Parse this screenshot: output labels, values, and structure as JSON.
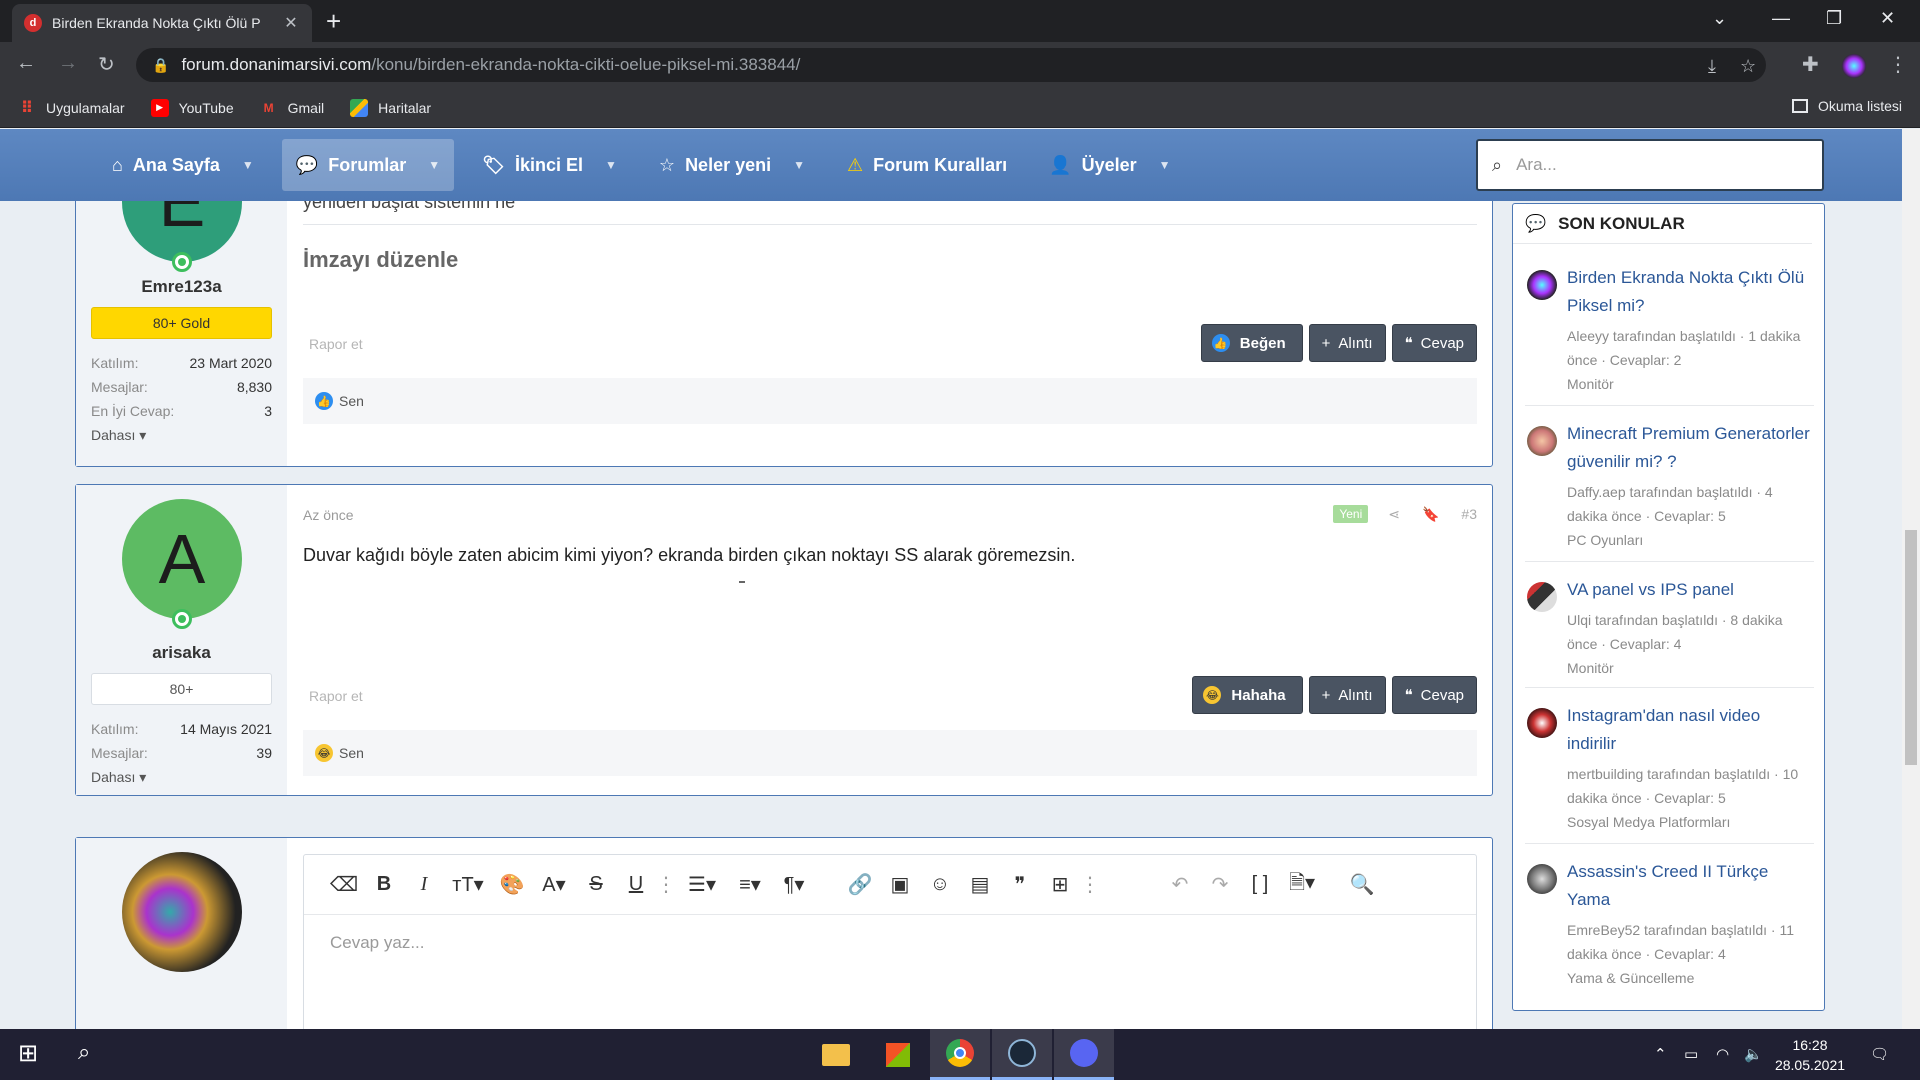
{
  "browser": {
    "tab_title": "Birden Ekranda Nokta Çıktı Ölü P",
    "url_host": "forum.donanimarsivi.com",
    "url_path": "/konu/birden-ekranda-nokta-cikti-oelue-piksel-mi.383844/",
    "bookmarks": [
      "Uygulamalar",
      "YouTube",
      "Gmail",
      "Haritalar"
    ],
    "reading_list": "Okuma listesi"
  },
  "nav": {
    "items": [
      "Ana Sayfa",
      "Forumlar",
      "İkinci El",
      "Neler yeni",
      "Forum Kuralları",
      "Üyeler"
    ],
    "search_placeholder": "Ara..."
  },
  "post1": {
    "avatar_letter": "E",
    "username": "Emre123a",
    "badge": "80+ Gold",
    "stats": [
      {
        "label": "Katılım:",
        "value": "23 Mart 2020"
      },
      {
        "label": "Mesajlar:",
        "value": "8,830"
      },
      {
        "label": "En İyi Cevap:",
        "value": "3"
      }
    ],
    "more": "Dahası",
    "partial_text": "yeniden başlat sistemin ne",
    "signature": "İmzayı düzenle",
    "report": "Rapor et",
    "btn_react": "Beğen",
    "btn_quote": "Alıntı",
    "btn_reply": "Cevap",
    "reaction_user": "Sen"
  },
  "post2": {
    "avatar_letter": "A",
    "username": "arisaka",
    "badge": "80+",
    "time": "Az önce",
    "new_badge": "Yeni",
    "post_number": "#3",
    "stats": [
      {
        "label": "Katılım:",
        "value": "14 Mayıs 2021"
      },
      {
        "label": "Mesajlar:",
        "value": "39"
      }
    ],
    "more": "Dahası",
    "message": "Duvar kağıdı böyle zaten abicim kimi yiyon? ekranda birden çıkan noktayı SS alarak göremezsin.",
    "report": "Rapor et",
    "btn_react": "Hahaha",
    "btn_quote": "Alıntı",
    "btn_reply": "Cevap",
    "reaction_user": "Sen"
  },
  "editor": {
    "placeholder": "Cevap yaz..."
  },
  "sidebar": {
    "title": "SON KONULAR",
    "items": [
      {
        "title": "Birden Ekranda Nokta Çıktı Ölü Piksel mi?",
        "meta": "Aleeyy tarafından başlatıldı · 1 dakika önce · Cevaplar: 2",
        "forum": "Monitör"
      },
      {
        "title": "Minecraft Premium Generatorler güvenilir mi? ?",
        "meta": "Daffy.aep tarafından başlatıldı · 4 dakika önce · Cevaplar: 5",
        "forum": "PC Oyunları"
      },
      {
        "title": "VA panel vs IPS panel",
        "meta": "Ulqi tarafından başlatıldı · 8 dakika önce · Cevaplar: 4",
        "forum": "Monitör"
      },
      {
        "title": "Instagram'dan nasıl video indirilir",
        "meta": "mertbuilding tarafından başlatıldı · 10 dakika önce · Cevaplar: 5",
        "forum": "Sosyal Medya Platformları"
      },
      {
        "title": "Assassin's Creed II Türkçe Yama",
        "meta": "EmreBey52 tarafından başlatıldı · 11 dakika önce · Cevaplar: 4",
        "forum": "Yama & Güncelleme"
      }
    ]
  },
  "taskbar": {
    "time": "16:28",
    "date": "28.05.2021"
  },
  "colors": {
    "nav_blue": "#5e88c2",
    "gold_badge": "#ffd700",
    "avatar_green": "#5dbb63",
    "avatar_teal": "#2e9e7a"
  }
}
